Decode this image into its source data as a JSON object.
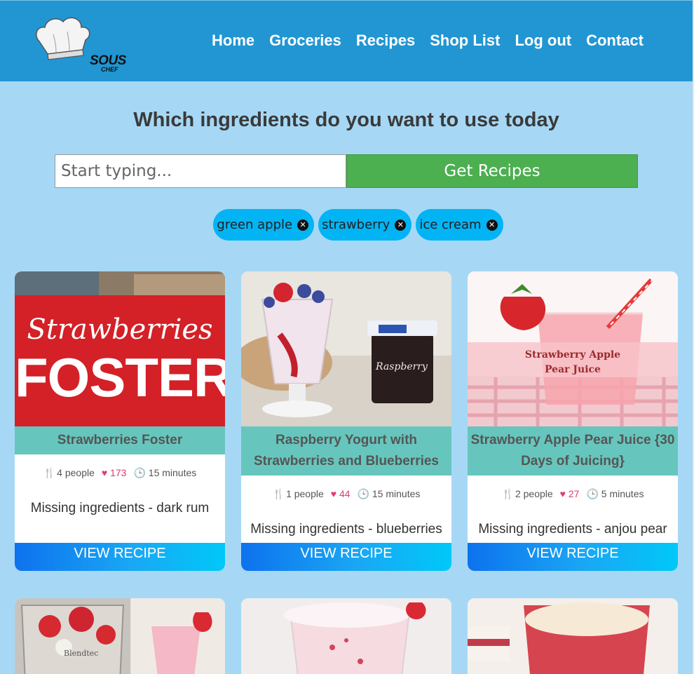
{
  "brand": {
    "line1": "SOUS",
    "line2": "CHEF"
  },
  "nav": [
    "Home",
    "Groceries",
    "Recipes",
    "Shop List",
    "Log out",
    "Contact"
  ],
  "heading": "Which ingredients do you want to use today",
  "search": {
    "placeholder": "Start typing...",
    "value": ""
  },
  "get_button": "Get Recipes",
  "chips": [
    "green apple",
    "strawberry",
    "ice cream"
  ],
  "cards": [
    {
      "title": "Strawberries Foster",
      "people": "4 people",
      "likes": "173",
      "time": "15 minutes",
      "missing": "Missing ingredients - dark rum",
      "button": "VIEW RECIPE",
      "img_line1": "Strawberries",
      "img_line2": "FOSTER"
    },
    {
      "title": "Raspberry Yogurt with Strawberries and Blueberries",
      "people": "1 people",
      "likes": "44",
      "time": "15 minutes",
      "missing": "Missing ingredients - blueberries",
      "button": "VIEW RECIPE",
      "img_label": "Raspberry"
    },
    {
      "title": "Strawberry Apple Pear Juice {30 Days of Juicing}",
      "people": "2 people",
      "likes": "27",
      "time": "5 minutes",
      "missing": "Missing ingredients - anjou pear",
      "button": "VIEW RECIPE",
      "img_line1": "Strawberry Apple",
      "img_line2": "Pear Juice"
    }
  ],
  "second_row_labels": {
    "blender": "Blendtec"
  },
  "colors": {
    "navbar": "#2196d3",
    "background": "#a6d8f5",
    "get_button": "#4caf50",
    "chip": "#03b4f4",
    "card_title": "#66c6bd",
    "likes": "#e23a6b"
  }
}
